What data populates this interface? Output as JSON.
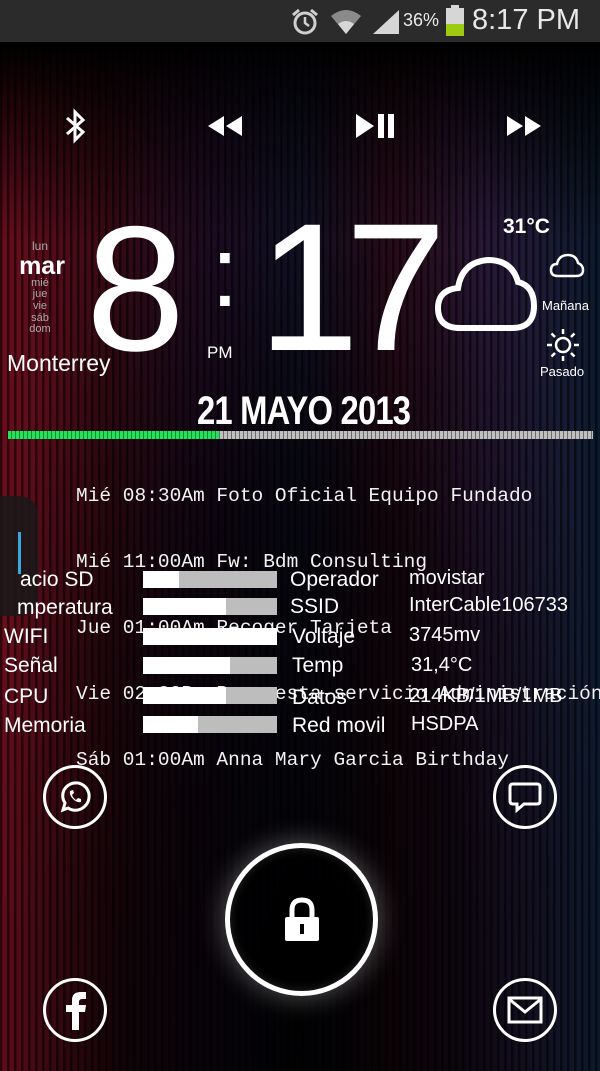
{
  "status_bar": {
    "battery_percent": "36%",
    "time": "8:17 PM",
    "icons": [
      "alarm-icon",
      "wifi-icon",
      "signal-icon",
      "battery-icon"
    ]
  },
  "media_controls": [
    "bluetooth-icon",
    "rewind-icon",
    "play-pause-icon",
    "fast-forward-icon"
  ],
  "clock": {
    "weekdays_above": [
      "lun"
    ],
    "current_weekday": "mar",
    "weekdays_below": [
      "mié",
      "jue",
      "vie",
      "sáb",
      "dom"
    ],
    "hour": "8",
    "separator": ":",
    "minutes": "17",
    "ampm": "PM",
    "city": "Monterrey",
    "date": "21 MAYO 2013"
  },
  "weather": {
    "temperature": "31°C",
    "main_icon": "cloud-icon",
    "tomorrow_label": "Mañana",
    "tomorrow_icon": "cloud-icon",
    "yesterday_label": "Pasado",
    "yesterday_icon": "sun-icon"
  },
  "day_progress": 0.36,
  "agenda": [
    "Mié 08:30Am Foto Oficial Equipo Fundado",
    "Mié 11:00Am Fw: Bdm Consulting",
    "Jue 01:00Am Recoger Tarjeta",
    "Vie 02:30Pm Propuesta-servicio Administración",
    "Sáb 01:00Am Anna Mary Garcia Birthday"
  ],
  "stats": [
    {
      "label": "acio SD",
      "level": 0.27
    },
    {
      "label": "mperatura",
      "level": 0.62
    },
    {
      "label": "WIFI",
      "level": 1.0
    },
    {
      "label": "Señal",
      "level": 0.65
    },
    {
      "label": "CPU",
      "level": 0.62
    },
    {
      "label": "Memoria",
      "level": 0.41
    }
  ],
  "info": [
    {
      "label": "Operador",
      "value": "movistar"
    },
    {
      "label": "SSID",
      "value": "InterCable106733"
    },
    {
      "label": "Voltaje",
      "value": "3745mv"
    },
    {
      "label": "Temp",
      "value": "31,4°C"
    },
    {
      "label": "Datos",
      "value": "214KB/1MB/1MB"
    },
    {
      "label": "Red movil",
      "value": "HSDPA"
    }
  ],
  "shortcuts": [
    "whatsapp-icon",
    "messaging-icon",
    "lock-icon",
    "facebook-icon",
    "email-icon"
  ],
  "colors": {
    "progress_green": "#22e35a",
    "status_bar": "#2b2b2b",
    "battery_green": "#9ccb12"
  }
}
